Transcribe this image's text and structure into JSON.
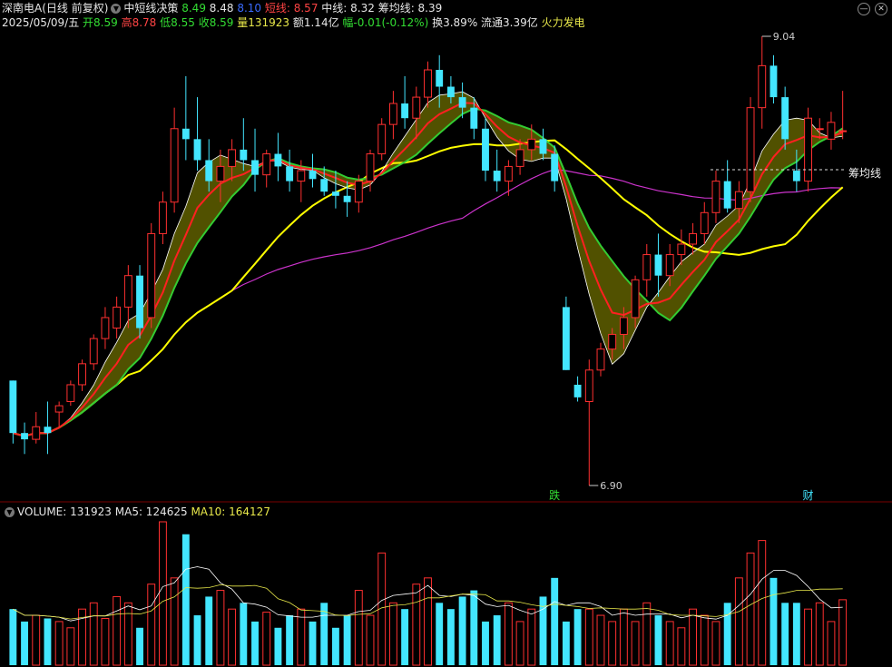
{
  "header": {
    "stock_name": "深南电A(日线 前复权)",
    "indicator_name": "中短线决策",
    "values": [
      {
        "v": "8.49",
        "color": "#33dd33"
      },
      {
        "v": "8.48",
        "color": "#e6e6e6"
      },
      {
        "v": "8.10",
        "color": "#3a6bff"
      },
      {
        "v": "短线: 8.57",
        "color": "#ff4444"
      },
      {
        "v": "中线: 8.32",
        "color": "#e6e6e6"
      },
      {
        "v": "筹均线: 8.39",
        "color": "#e6e6e6"
      }
    ],
    "date": "2025/05/09/五",
    "quote": [
      {
        "label": "开",
        "value": "8.59",
        "color": "#33dd33"
      },
      {
        "label": "高",
        "value": "8.78",
        "color": "#ff4444"
      },
      {
        "label": "低",
        "value": "8.55",
        "color": "#33dd33"
      },
      {
        "label": "收",
        "value": "8.59",
        "color": "#33dd33"
      },
      {
        "label": "量",
        "value": "131923",
        "color": "#e8e84a"
      },
      {
        "label": "额",
        "value": "1.14亿",
        "color": "#e6e6e6"
      },
      {
        "label": "幅",
        "value": "-0.01(-0.12%)",
        "color": "#33dd33"
      },
      {
        "label": "换",
        "value": "3.89%",
        "color": "#e6e6e6"
      },
      {
        "label": "流通",
        "value": "3.39亿",
        "color": "#e6e6e6"
      }
    ],
    "sector": "火力发电",
    "sector_color": "#e8e84a"
  },
  "volume_header": {
    "volume": "VOLUME: 131923",
    "ma5": "MA5: 124625",
    "ma10": "MA10: 164127"
  },
  "annotations": {
    "high_label": "9.04",
    "low_label": "6.90",
    "chip_line_label": "筹均线",
    "marker_die": "跌",
    "marker_cai": "财"
  },
  "chart_data": {
    "type": "candlestick",
    "price_range": [
      6.9,
      9.04
    ],
    "candles": [
      [
        7.4,
        7.4,
        7.1,
        7.15
      ],
      [
        7.15,
        7.2,
        7.05,
        7.12
      ],
      [
        7.12,
        7.25,
        7.1,
        7.18
      ],
      [
        7.18,
        7.3,
        7.05,
        7.15
      ],
      [
        7.25,
        7.3,
        7.18,
        7.28
      ],
      [
        7.3,
        7.4,
        7.28,
        7.38
      ],
      [
        7.38,
        7.5,
        7.35,
        7.48
      ],
      [
        7.48,
        7.62,
        7.45,
        7.6
      ],
      [
        7.6,
        7.75,
        7.55,
        7.7
      ],
      [
        7.65,
        7.8,
        7.6,
        7.75
      ],
      [
        7.75,
        7.95,
        7.65,
        7.9
      ],
      [
        7.9,
        7.95,
        7.6,
        7.65
      ],
      [
        7.7,
        8.15,
        7.65,
        8.1
      ],
      [
        8.1,
        8.3,
        8.05,
        8.25
      ],
      [
        8.25,
        8.7,
        8.2,
        8.6
      ],
      [
        8.6,
        8.85,
        8.45,
        8.55
      ],
      [
        8.55,
        8.75,
        8.4,
        8.45
      ],
      [
        8.45,
        8.55,
        8.3,
        8.35
      ],
      [
        8.35,
        8.5,
        8.25,
        8.42
      ],
      [
        8.42,
        8.55,
        8.35,
        8.5
      ],
      [
        8.5,
        8.65,
        8.4,
        8.45
      ],
      [
        8.45,
        8.6,
        8.3,
        8.38
      ],
      [
        8.38,
        8.5,
        8.32,
        8.48
      ],
      [
        8.48,
        8.58,
        8.35,
        8.42
      ],
      [
        8.42,
        8.5,
        8.3,
        8.35
      ],
      [
        8.35,
        8.45,
        8.25,
        8.4
      ],
      [
        8.4,
        8.48,
        8.32,
        8.36
      ],
      [
        8.36,
        8.42,
        8.28,
        8.3
      ],
      [
        8.3,
        8.4,
        8.22,
        8.28
      ],
      [
        8.28,
        8.35,
        8.18,
        8.25
      ],
      [
        8.25,
        8.38,
        8.2,
        8.35
      ],
      [
        8.35,
        8.5,
        8.3,
        8.48
      ],
      [
        8.48,
        8.65,
        8.45,
        8.62
      ],
      [
        8.62,
        8.78,
        8.55,
        8.72
      ],
      [
        8.72,
        8.85,
        8.6,
        8.65
      ],
      [
        8.65,
        8.8,
        8.55,
        8.75
      ],
      [
        8.75,
        8.92,
        8.7,
        8.88
      ],
      [
        8.88,
        8.95,
        8.7,
        8.8
      ],
      [
        8.8,
        8.85,
        8.72,
        8.75
      ],
      [
        8.75,
        8.82,
        8.65,
        8.7
      ],
      [
        8.7,
        8.75,
        8.55,
        8.6
      ],
      [
        8.6,
        8.65,
        8.35,
        8.4
      ],
      [
        8.4,
        8.5,
        8.3,
        8.35
      ],
      [
        8.35,
        8.45,
        8.28,
        8.42
      ],
      [
        8.42,
        8.55,
        8.38,
        8.5
      ],
      [
        8.5,
        8.62,
        8.45,
        8.55
      ],
      [
        8.55,
        8.6,
        8.45,
        8.48
      ],
      [
        8.48,
        8.52,
        8.3,
        8.35
      ],
      [
        7.75,
        7.8,
        7.45,
        7.45
      ],
      [
        7.38,
        7.42,
        7.3,
        7.32
      ],
      [
        7.3,
        7.5,
        6.9,
        7.45
      ],
      [
        7.45,
        7.58,
        7.42,
        7.55
      ],
      [
        7.55,
        7.65,
        7.5,
        7.62
      ],
      [
        7.62,
        7.75,
        7.55,
        7.7
      ],
      [
        7.7,
        7.9,
        7.65,
        7.88
      ],
      [
        7.88,
        8.05,
        7.8,
        8.0
      ],
      [
        8.0,
        8.1,
        7.8,
        7.9
      ],
      [
        7.9,
        8.05,
        7.85,
        8.0
      ],
      [
        8.0,
        8.12,
        7.95,
        8.05
      ],
      [
        8.05,
        8.15,
        8.0,
        8.1
      ],
      [
        8.1,
        8.25,
        8.05,
        8.2
      ],
      [
        8.2,
        8.4,
        8.15,
        8.35
      ],
      [
        8.35,
        8.45,
        8.2,
        8.22
      ],
      [
        8.22,
        8.35,
        8.15,
        8.3
      ],
      [
        8.3,
        8.75,
        8.25,
        8.7
      ],
      [
        8.7,
        9.04,
        8.6,
        8.9
      ],
      [
        8.9,
        8.95,
        8.72,
        8.75
      ],
      [
        8.75,
        8.8,
        8.5,
        8.55
      ],
      [
        8.4,
        8.5,
        8.3,
        8.35
      ],
      [
        8.35,
        8.7,
        8.3,
        8.65
      ],
      [
        8.6,
        8.65,
        8.55,
        8.6
      ],
      [
        8.55,
        8.68,
        8.5,
        8.63
      ],
      [
        8.59,
        8.78,
        8.55,
        8.59
      ]
    ],
    "series": [
      {
        "name": "短线",
        "color": "#ff2020"
      },
      {
        "name": "中线",
        "color": "#ffff00"
      },
      {
        "name": "筹均线",
        "color": "#cc33cc"
      }
    ],
    "volume": [
      18,
      14,
      16,
      15,
      14,
      12,
      18,
      20,
      15,
      22,
      20,
      12,
      26,
      46,
      28,
      42,
      16,
      22,
      24,
      18,
      20,
      14,
      17,
      12,
      16,
      18,
      14,
      20,
      12,
      16,
      24,
      16,
      36,
      20,
      18,
      26,
      28,
      20,
      18,
      22,
      24,
      14,
      16,
      20,
      14,
      18,
      22,
      28,
      14,
      18,
      18,
      16,
      14,
      18,
      14,
      20,
      16,
      14,
      12,
      18,
      16,
      14,
      20,
      28,
      36,
      40,
      28,
      20,
      20,
      18,
      20,
      14,
      21
    ]
  }
}
